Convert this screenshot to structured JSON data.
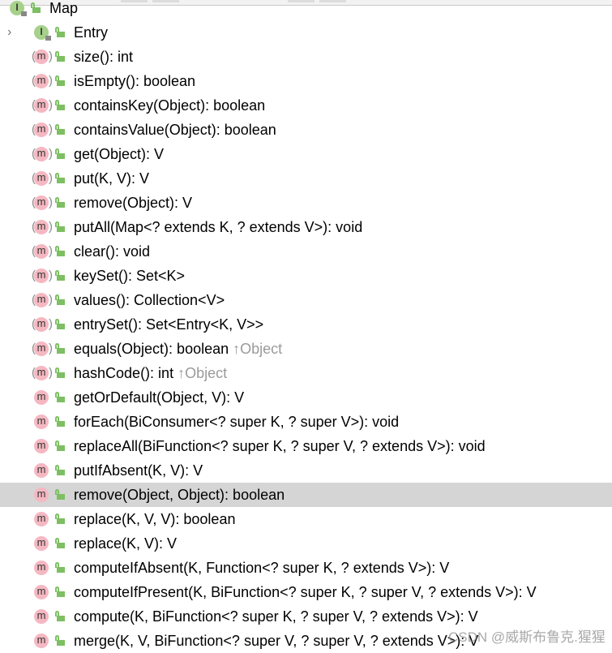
{
  "tree": {
    "root": {
      "label": "Map",
      "kind": "interface"
    },
    "nested": {
      "label": "Entry",
      "kind": "interface"
    },
    "methods": [
      {
        "label": "size(): int",
        "abstract": true
      },
      {
        "label": "isEmpty(): boolean",
        "abstract": true
      },
      {
        "label": "containsKey(Object): boolean",
        "abstract": true
      },
      {
        "label": "containsValue(Object): boolean",
        "abstract": true
      },
      {
        "label": "get(Object): V",
        "abstract": true
      },
      {
        "label": "put(K, V): V",
        "abstract": true
      },
      {
        "label": "remove(Object): V",
        "abstract": true
      },
      {
        "label": "putAll(Map<? extends K, ? extends V>): void",
        "abstract": true
      },
      {
        "label": "clear(): void",
        "abstract": true
      },
      {
        "label": "keySet(): Set<K>",
        "abstract": true
      },
      {
        "label": "values(): Collection<V>",
        "abstract": true
      },
      {
        "label": "entrySet(): Set<Entry<K, V>>",
        "abstract": true
      },
      {
        "label": "equals(Object): boolean",
        "inherited": "↑Object",
        "abstract": true
      },
      {
        "label": "hashCode(): int",
        "inherited": "↑Object",
        "abstract": true
      },
      {
        "label": "getOrDefault(Object, V): V",
        "abstract": false
      },
      {
        "label": "forEach(BiConsumer<? super K, ? super V>): void",
        "abstract": false
      },
      {
        "label": "replaceAll(BiFunction<? super K, ? super V, ? extends V>): void",
        "abstract": false
      },
      {
        "label": "putIfAbsent(K, V): V",
        "abstract": false
      },
      {
        "label": "remove(Object, Object): boolean",
        "abstract": false,
        "selected": true
      },
      {
        "label": "replace(K, V, V): boolean",
        "abstract": false
      },
      {
        "label": "replace(K, V): V",
        "abstract": false
      },
      {
        "label": "computeIfAbsent(K, Function<? super K, ? extends V>): V",
        "abstract": false
      },
      {
        "label": "computeIfPresent(K, BiFunction<? super K, ? super V, ? extends V>): V",
        "abstract": false
      },
      {
        "label": "compute(K, BiFunction<? super K, ? super V, ? extends V>): V",
        "abstract": false
      },
      {
        "label": "merge(K, V, BiFunction<? super V, ? super V, ? extends V>): V",
        "abstract": false
      }
    ]
  },
  "icons": {
    "interface": "I",
    "method": "m",
    "expand": "›"
  },
  "colors": {
    "method_icon": "#f5b8c2",
    "interface_icon": "#a6d18b",
    "public_lock": "#7dbf62",
    "selection": "#d5d5d5"
  },
  "watermark": "CSDN @威斯布鲁克.猩猩"
}
